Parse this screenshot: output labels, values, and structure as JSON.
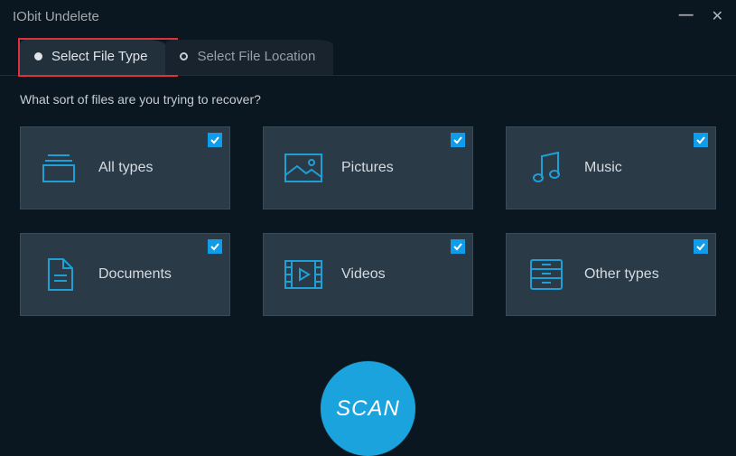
{
  "app": {
    "title": "IObit Undelete"
  },
  "tabs": [
    {
      "label": "Select File Type",
      "active": true,
      "highlighted": true
    },
    {
      "label": "Select File Location",
      "active": false,
      "highlighted": false
    }
  ],
  "prompt": "What sort of files are you trying to recover?",
  "types": [
    {
      "key": "all",
      "label": "All types",
      "checked": true,
      "icon": "stack-icon"
    },
    {
      "key": "pictures",
      "label": "Pictures",
      "checked": true,
      "icon": "picture-icon"
    },
    {
      "key": "music",
      "label": "Music",
      "checked": true,
      "icon": "music-icon"
    },
    {
      "key": "documents",
      "label": "Documents",
      "checked": true,
      "icon": "document-icon"
    },
    {
      "key": "videos",
      "label": "Videos",
      "checked": true,
      "icon": "video-icon"
    },
    {
      "key": "other",
      "label": "Other types",
      "checked": true,
      "icon": "drawer-icon"
    }
  ],
  "scan_label": "SCAN",
  "colors": {
    "accent": "#1aa3dd",
    "icon": "#1f9fd6",
    "bg": "#0a1620",
    "card": "#2a3a47",
    "highlight": "#d9333f"
  }
}
